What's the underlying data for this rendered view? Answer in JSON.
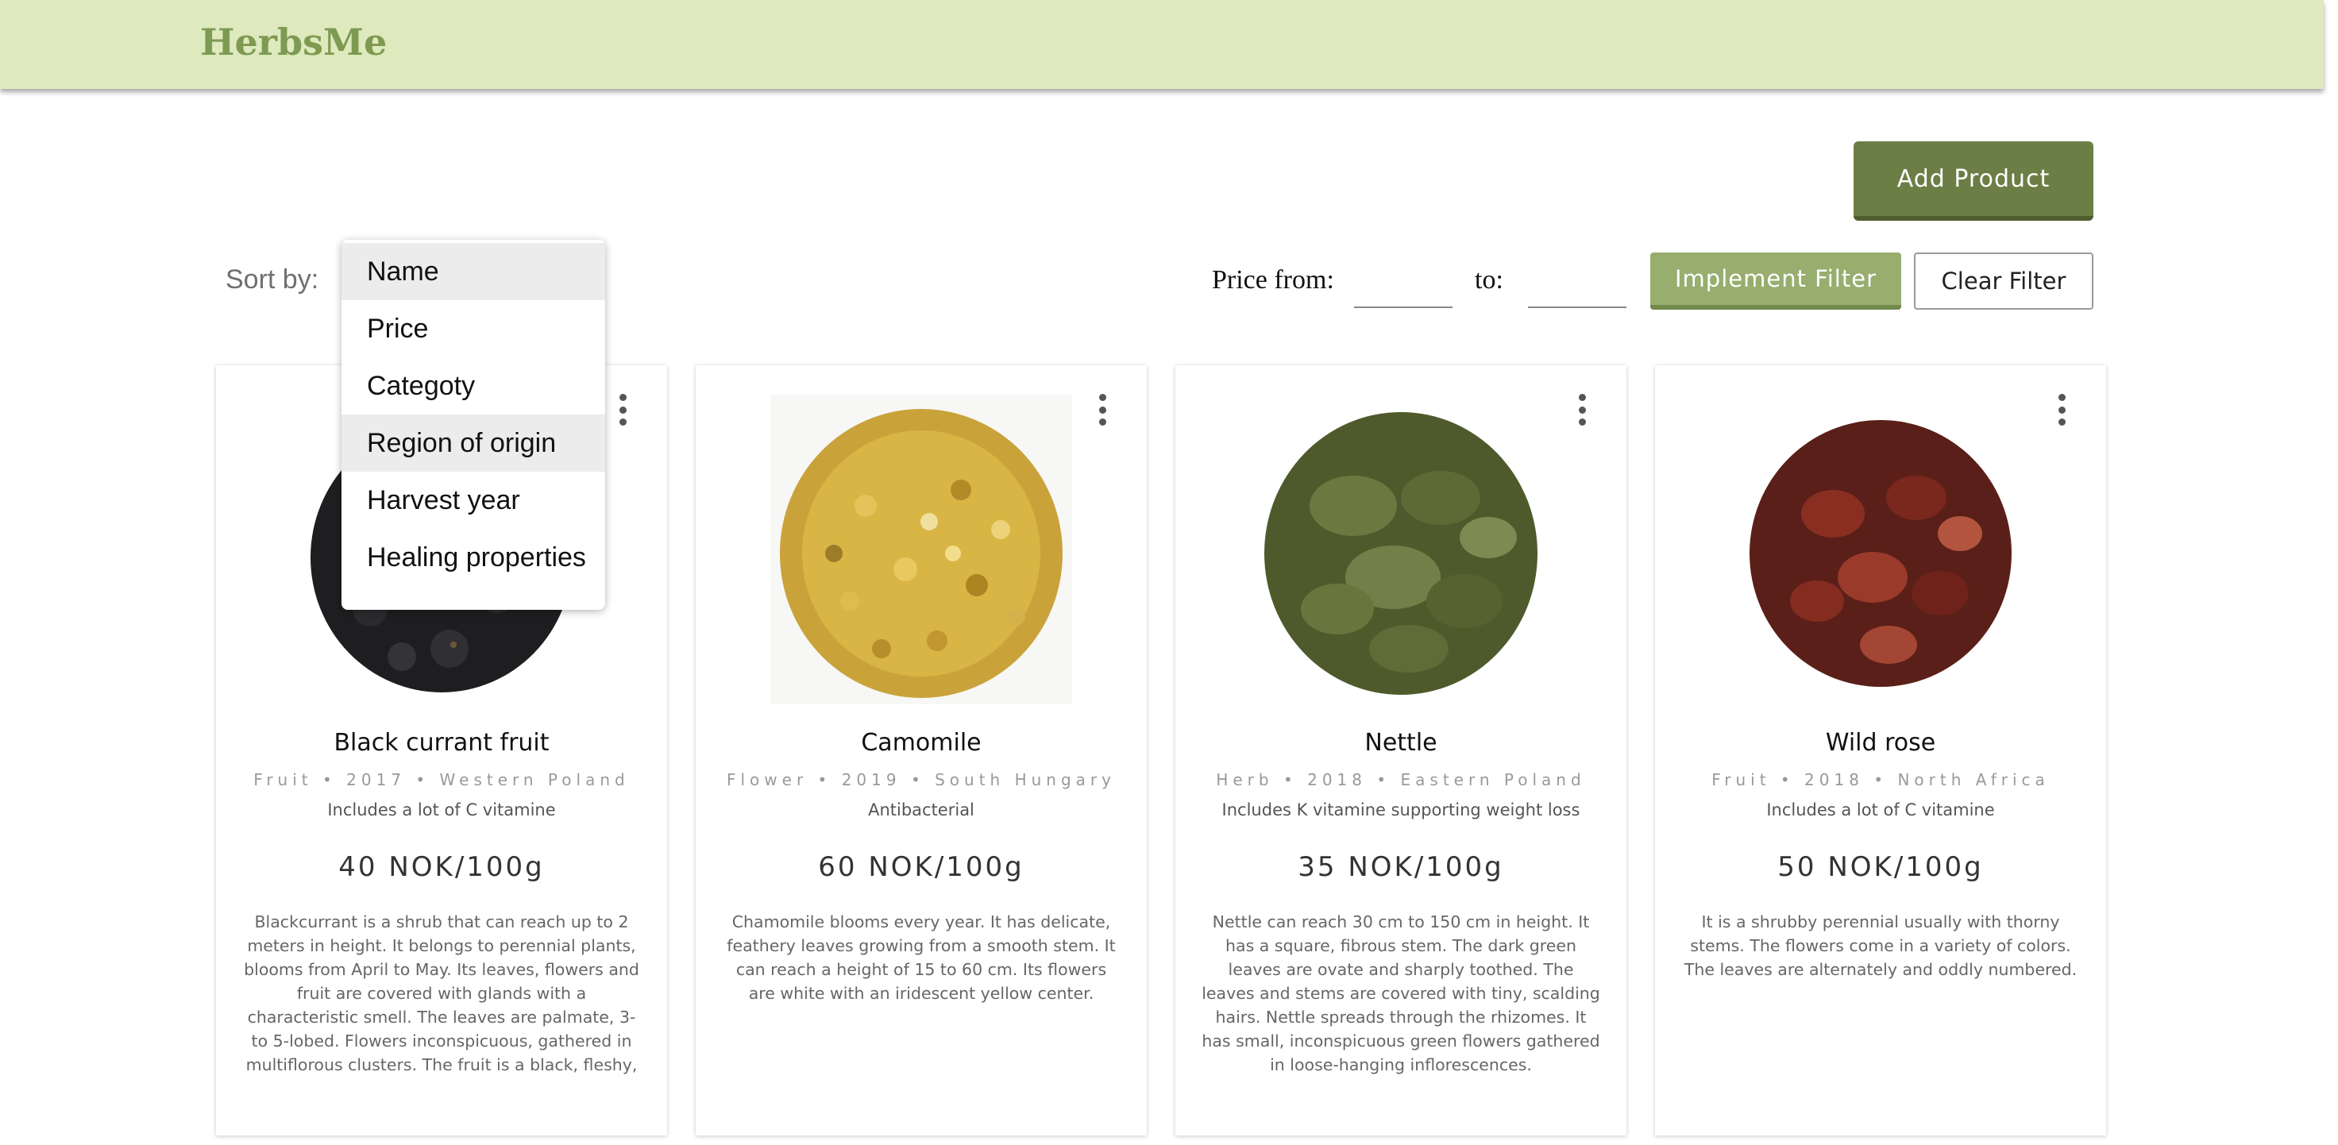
{
  "header": {
    "brand": "HerbsMe"
  },
  "toolbar": {
    "add_product_label": "Add Product",
    "sort_label": "Sort by:",
    "sort_options": [
      "Name",
      "Price",
      "Categoty",
      "Region of origin",
      "Harvest year",
      "Healing properties"
    ],
    "price_from_label": "Price from:",
    "price_to_label": "to:",
    "price_from_value": "",
    "price_to_value": "",
    "implement_filter_label": "Implement Filter",
    "clear_filter_label": "Clear Filter"
  },
  "colors": {
    "header_bg": "#dee9bd",
    "brand": "#7e9a52",
    "add_button": "#6b7e45",
    "implement_button": "#97ae6f"
  },
  "products": [
    {
      "name": "Black currant fruit",
      "meta": "Fruit • 2017 • Western Poland",
      "feature": "Includes a lot of C vitamine",
      "price": "40 NOK/100g",
      "description": "Blackcurrant is a shrub that can reach up to 2 meters in height. It belongs to perennial plants, blooms from April to May. Its leaves, flowers and fruit are covered with glands with a characteristic smell. The leaves are palmate, 3- to 5-lobed. Flowers inconspicuous, gathered in multiflorous clusters. The fruit is a black, fleshy,",
      "image_icon": "black-currant-image"
    },
    {
      "name": "Camomile",
      "meta": "Flower • 2019 • South Hungary",
      "feature": "Antibacterial",
      "price": "60 NOK/100g",
      "description": "Chamomile blooms every year. It has delicate, feathery leaves growing from a smooth stem. It can reach a height of 15 to 60 cm. Its flowers are white with an iridescent yellow center.",
      "image_icon": "camomile-image"
    },
    {
      "name": "Nettle",
      "meta": "Herb • 2018 • Eastern Poland",
      "feature": "Includes K vitamine supporting weight loss",
      "price": "35 NOK/100g",
      "description": "Nettle can reach 30 cm to 150 cm in height. It has a square, fibrous stem. The dark green leaves are ovate and sharply toothed. The leaves and stems are covered with tiny, scalding hairs. Nettle spreads through the rhizomes. It has small, inconspicuous green flowers gathered in loose-hanging inflorescences.",
      "image_icon": "nettle-image"
    },
    {
      "name": "Wild rose",
      "meta": "Fruit • 2018 • North Africa",
      "feature": "Includes a lot of C vitamine",
      "price": "50 NOK/100g",
      "description": "It is a shrubby perennial usually with thorny stems. The flowers come in a variety of colors. The leaves are alternately and oddly numbered.",
      "image_icon": "wild-rose-image"
    }
  ]
}
